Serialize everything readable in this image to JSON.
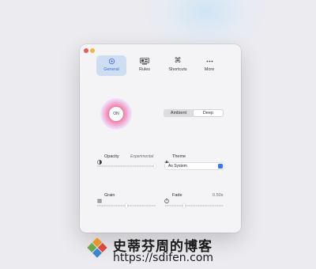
{
  "tabs": [
    {
      "label": "General",
      "icon": "gear-icon",
      "active": true
    },
    {
      "label": "Rules",
      "icon": "rules-icon",
      "active": false
    },
    {
      "label": "Shortcuts",
      "icon": "command-icon",
      "active": false
    },
    {
      "label": "More",
      "icon": "ellipsis-icon",
      "active": false
    }
  ],
  "toggle": {
    "label": "ON"
  },
  "mode": {
    "options": [
      "Ambient",
      "Deep"
    ],
    "selected": "Deep"
  },
  "opacity": {
    "label": "Opacity",
    "note": "Experimental",
    "value": 1.0
  },
  "theme": {
    "label": "Theme",
    "selected": "As System"
  },
  "grain": {
    "label": "Grain",
    "value": 0.5
  },
  "fade": {
    "label": "Fade",
    "value_text": "0.50s",
    "value": 0.3
  },
  "watermark": {
    "name": "史蒂芬周的博客",
    "url": "https://sdifen.com"
  },
  "colors": {
    "accent": "#3b6ed8",
    "close": "#ee5a52",
    "minimize": "#f2b640"
  }
}
